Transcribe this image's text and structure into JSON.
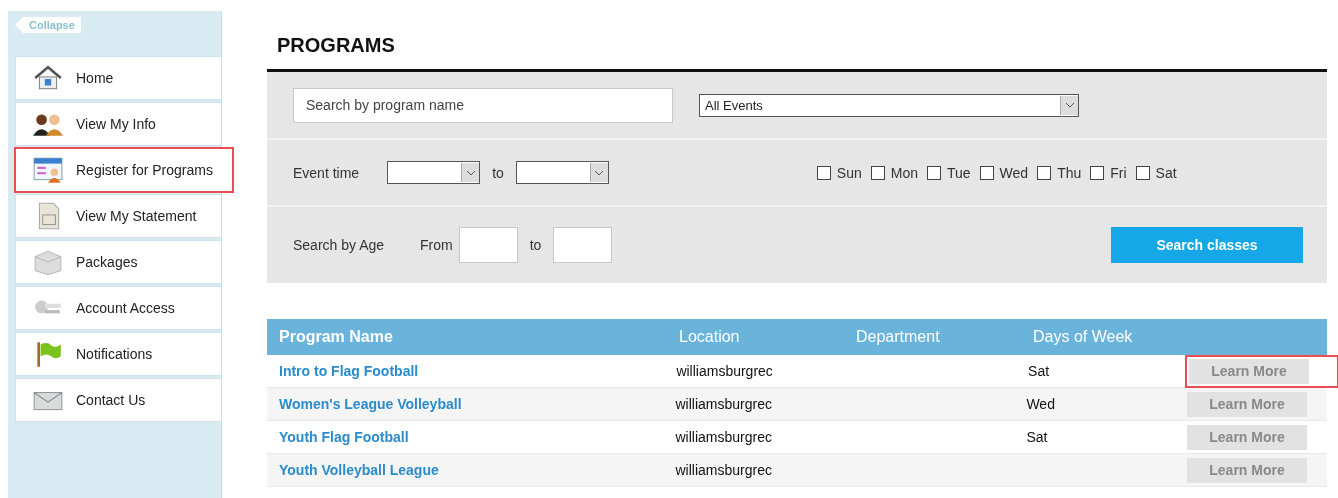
{
  "sidebar": {
    "collapse": "Collapse",
    "items": [
      {
        "label": "Home",
        "kind": "home",
        "highlighted": false
      },
      {
        "label": "View My Info",
        "kind": "people",
        "highlighted": false
      },
      {
        "label": "Register for Programs",
        "kind": "register",
        "highlighted": true
      },
      {
        "label": "View My Statement",
        "kind": "statement",
        "highlighted": false
      },
      {
        "label": "Packages",
        "kind": "package",
        "highlighted": false
      },
      {
        "label": "Account Access",
        "kind": "keys",
        "highlighted": false
      },
      {
        "label": "Notifications",
        "kind": "flag",
        "highlighted": false
      },
      {
        "label": "Contact Us",
        "kind": "mail",
        "highlighted": false
      }
    ]
  },
  "title": "PROGRAMS",
  "filters": {
    "search": {
      "placeholder": "Search by program name"
    },
    "event_select": "All Events",
    "event_time_label": "Event time",
    "to_label": "to",
    "days": [
      {
        "label": "Sun",
        "checked": false
      },
      {
        "label": "Mon",
        "checked": false
      },
      {
        "label": "Tue",
        "checked": false
      },
      {
        "label": "Wed",
        "checked": false
      },
      {
        "label": "Thu",
        "checked": false
      },
      {
        "label": "Fri",
        "checked": false
      },
      {
        "label": "Sat",
        "checked": false
      }
    ],
    "age_label": "Search by Age",
    "from_label": "From",
    "age_to_label": "to",
    "search_button": "Search classes"
  },
  "table": {
    "columns": [
      "Program Name",
      "Location",
      "Department",
      "Days of Week"
    ],
    "rows": [
      {
        "name": "Intro to Flag Football",
        "location": "williamsburgrec",
        "days": "Sat",
        "button": "Learn More",
        "highlighted": true
      },
      {
        "name": "Women's League Volleyball",
        "location": "williamsburgrec",
        "days": "Wed",
        "button": "Learn More",
        "highlighted": false
      },
      {
        "name": "Youth Flag Football",
        "location": "williamsburgrec",
        "days": "Sat",
        "button": "Learn More",
        "highlighted": false
      },
      {
        "name": "Youth Volleyball League",
        "location": "williamsburgrec",
        "button": "Learn More",
        "highlighted": false
      }
    ]
  }
}
